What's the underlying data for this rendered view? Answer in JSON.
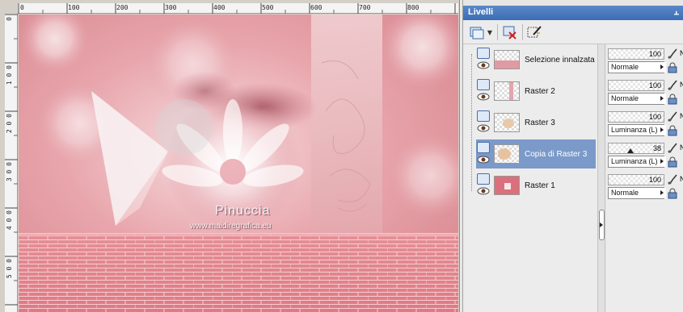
{
  "canvas": {
    "watermark_title": "Pinuccia",
    "watermark_url": "www.maidiregrafica.eu",
    "hruler_labels": [
      "0",
      "100",
      "200",
      "300",
      "400",
      "500",
      "600",
      "700",
      "800"
    ],
    "vruler_labels": [
      "0",
      "1 0 0",
      "2 0 0",
      "3 0 0",
      "4 0 0",
      "5 0 0"
    ]
  },
  "panel": {
    "title": "Livelli",
    "pin_icon": "pin-icon",
    "toolbar": {
      "new_layer_icon": "new-raster-layer-icon",
      "delete_icon": "delete-layer-icon",
      "properties_icon": "layer-properties-icon"
    }
  },
  "layers": [
    {
      "name": "Selezione innalzata",
      "opacity": "100",
      "blend": "Normale",
      "selected": false
    },
    {
      "name": "Raster 2",
      "opacity": "100",
      "blend": "Normale",
      "selected": false
    },
    {
      "name": "Raster 3",
      "opacity": "100",
      "blend": "Luminanza (L)",
      "selected": false
    },
    {
      "name": "Copia di Raster 3",
      "opacity": "38",
      "blend": "Luminanza (L)",
      "selected": true
    },
    {
      "name": "Raster 1",
      "opacity": "100",
      "blend": "Normale",
      "selected": false
    }
  ],
  "props_clip_letter": "N",
  "colors": {
    "selected_row": "#7b99c9",
    "title_bar": "#3b6db4",
    "image_pink": "#e0a3a8"
  }
}
